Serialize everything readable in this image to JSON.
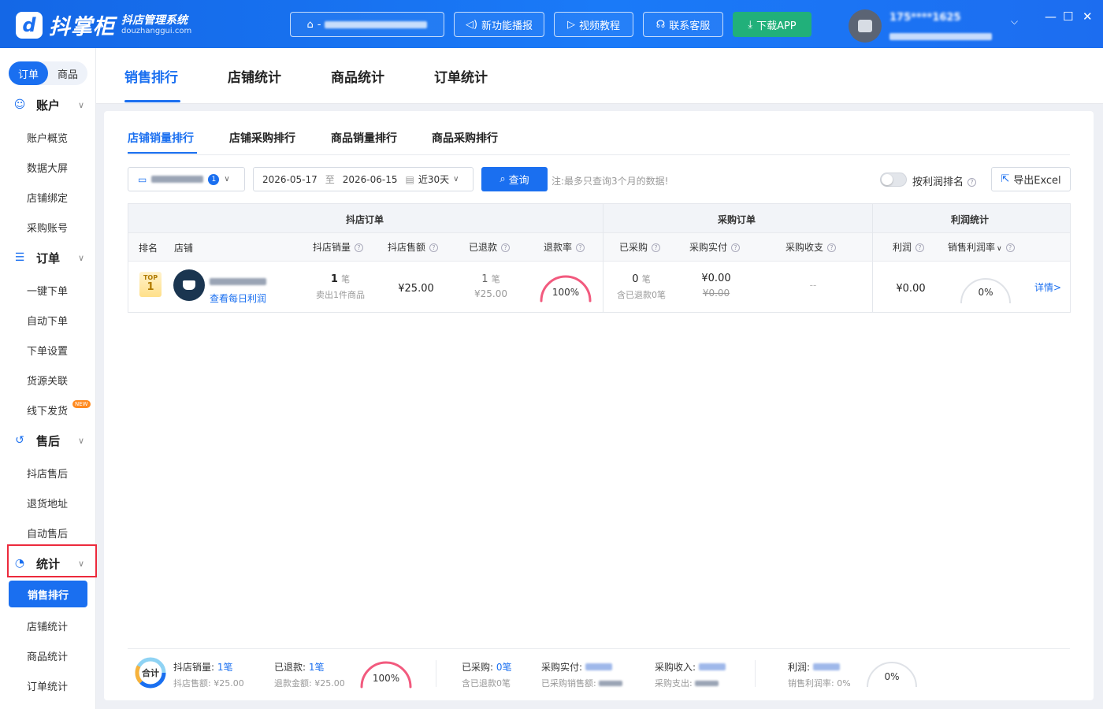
{
  "app": {
    "logo_mark": "d",
    "name": "抖掌柜",
    "subtitle": "抖店管理系统",
    "domain": "douzhanggui.com"
  },
  "topbar": {
    "shop_selector_prefix": "-",
    "buttons": [
      "新功能播报",
      "视频教程",
      "联系客服",
      "下载APP"
    ],
    "user_phone": "175****1625"
  },
  "sidebar": {
    "toggle": [
      "订单",
      "商品"
    ],
    "groups": [
      {
        "label": "账户",
        "icon": "smile-icon",
        "items": [
          "账户概览",
          "数据大屏",
          "店铺绑定",
          "采购账号"
        ]
      },
      {
        "label": "订单",
        "icon": "list-icon",
        "items": [
          "一键下单",
          "自动下单",
          "下单设置",
          "货源关联",
          "线下发货"
        ]
      },
      {
        "label": "售后",
        "icon": "return-icon",
        "items": [
          "抖店售后",
          "退货地址",
          "自动售后"
        ]
      },
      {
        "label": "统计",
        "icon": "pie-chart-icon",
        "items": [
          "销售排行",
          "店铺统计",
          "商品统计",
          "订单统计"
        ]
      }
    ],
    "new_badge": "NEW"
  },
  "main_tabs": [
    "销售排行",
    "店铺统计",
    "商品统计",
    "订单统计"
  ],
  "sub_tabs": [
    "店铺销量排行",
    "店铺采购排行",
    "商品销量排行",
    "商品采购排行"
  ],
  "filters": {
    "shop_count": "1",
    "date_from": "2026-05-17",
    "date_sep": "至",
    "date_to": "2026-06-15",
    "preset": "近30天",
    "query_label": "查询",
    "note": "注:最多只查询3个月的数据!",
    "sort_by_profit": "按利润排名",
    "export_label": "导出Excel"
  },
  "table": {
    "groups": [
      "抖店订单",
      "采购订单",
      "利润统计"
    ],
    "headers": [
      "排名",
      "店铺",
      "抖店销量",
      "抖店售额",
      "已退款",
      "退款率",
      "已采购",
      "采购实付",
      "采购收支",
      "利润",
      "销售利润率"
    ],
    "rows": [
      {
        "rank_badge": "TOP",
        "rank": "1",
        "shop_link": "查看每日利润",
        "sales_qty": "1",
        "qty_unit": "笔",
        "sales_sub": "卖出1件商品",
        "sales_amount": "¥25.00",
        "refund_qty": "1",
        "refund_amount": "¥25.00",
        "refund_rate": "100%",
        "refund_rate_value": 100,
        "purchased": "0",
        "purchased_sub": "含已退款0笔",
        "purchase_paid": "¥0.00",
        "purchase_paid_strike": "¥0.00",
        "purchase_balance": "--",
        "profit": "¥0.00",
        "margin": "0%",
        "margin_value": 0,
        "detail_link": "详情>"
      }
    ]
  },
  "footer": {
    "total_label": "合计",
    "sales_qty_label": "抖店销量:",
    "sales_qty": "1笔",
    "sales_amount_label": "抖店售额:",
    "sales_amount": "¥25.00",
    "refund_label": "已退款:",
    "refund": "1笔",
    "refund_amount_label": "退款金额:",
    "refund_amount": "¥25.00",
    "refund_rate": "100%",
    "refund_rate_value": 100,
    "purchased_label": "已采购:",
    "purchased": "0笔",
    "purchased_sub": "含已退款0笔",
    "purchase_paid_label": "采购实付:",
    "purchase_sales_label": "已采购销售额:",
    "purchase_income_label": "采购收入:",
    "purchase_expense_label": "采购支出:",
    "profit_label": "利润:",
    "margin_label": "销售利润率:",
    "margin": "0%",
    "margin_gauge": "0%",
    "margin_value": 0
  },
  "colors": {
    "primary": "#1a6ff0",
    "refund_arc": "#f25a7e",
    "gauge_track": "#e5e7eb",
    "highlight": "#ec2a3c",
    "download": "#21b07a"
  }
}
